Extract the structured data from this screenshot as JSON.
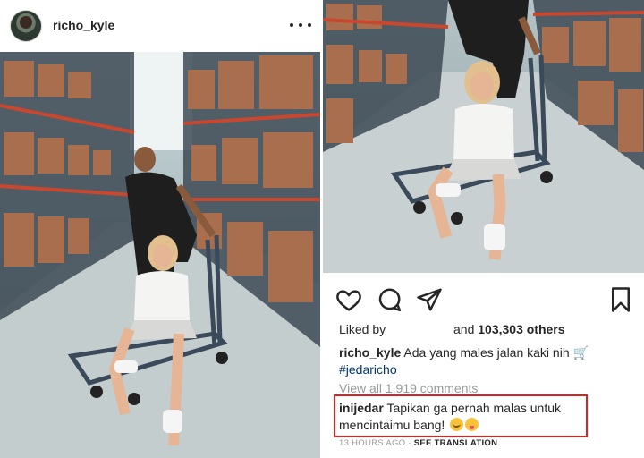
{
  "left_post": {
    "username": "richo_kyle",
    "avatar_icon": "profile-avatar",
    "more_icon": "more-options-icon"
  },
  "right_post": {
    "actions": {
      "like_icon": "heart-icon",
      "comment_icon": "comment-icon",
      "share_icon": "paper-plane-icon",
      "save_icon": "bookmark-icon"
    },
    "liked_by_label": "Liked by",
    "likes_and": "and",
    "likes_count": "103,303 others",
    "caption_user": "richo_kyle",
    "caption_text": "Ada yang males jalan kaki nih",
    "caption_emoji": "🛒",
    "caption_tag": "#jedaricho",
    "view_comments": "View all 1,919 comments",
    "comment_user": "inijedar",
    "comment_text": "Tapikan ga pernah malas untuk mencintaimu bang!",
    "comment_emojis": [
      "blush-emoji",
      "tongue-emoji"
    ],
    "timestamp": "13 HOURS AGO",
    "separator": "·",
    "see_translation": "SEE TRANSLATION",
    "highlight_color": "#e0201f"
  }
}
